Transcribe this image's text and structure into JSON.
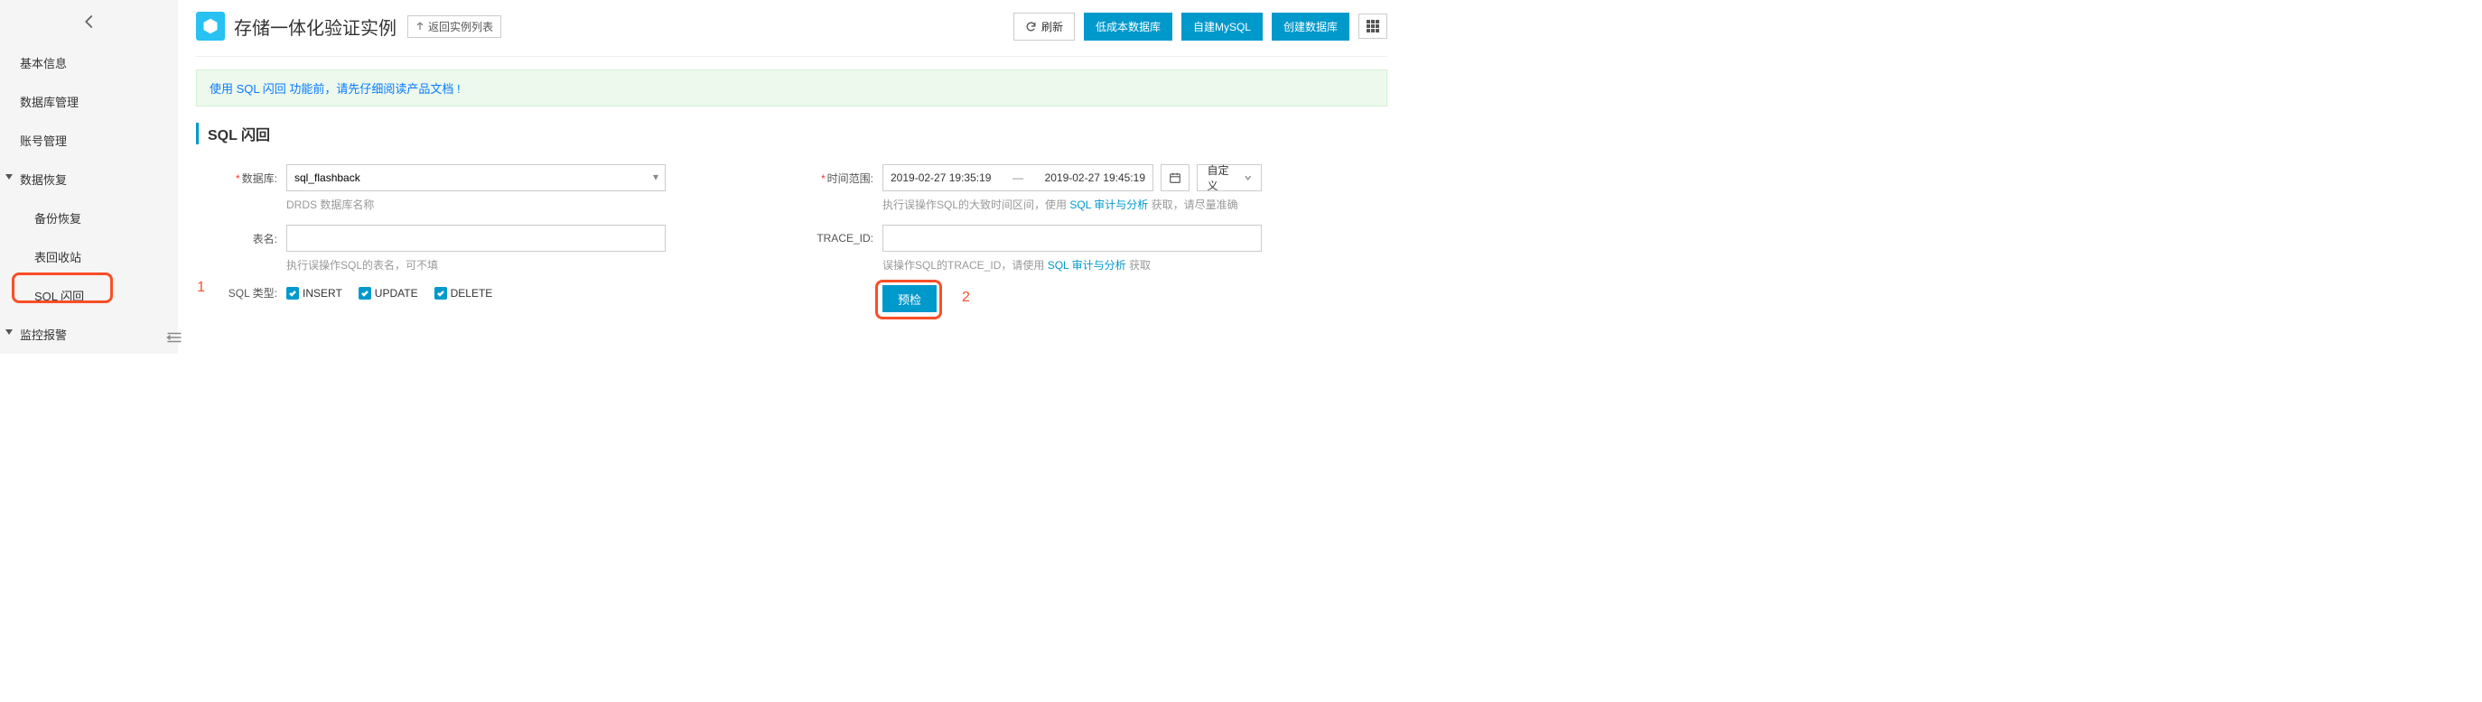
{
  "sidebar": {
    "items": [
      {
        "label": "基本信息"
      },
      {
        "label": "数据库管理"
      },
      {
        "label": "账号管理"
      }
    ],
    "group_recover": "数据恢复",
    "recover_children": [
      {
        "label": "备份恢复"
      },
      {
        "label": "表回收站"
      },
      {
        "label": "SQL 闪回"
      }
    ],
    "group_monitor": "监控报警",
    "annotation_1": "1"
  },
  "header": {
    "title": "存储一体化验证实例",
    "back_list": "返回实例列表",
    "refresh": "刷新",
    "btn_lowcost": "低成本数据库",
    "btn_selfmysql": "自建MySQL",
    "btn_createdb": "创建数据库"
  },
  "notice": {
    "text": "使用 SQL 闪回 功能前，请先仔细阅读产品文档 !"
  },
  "section_title": "SQL 闪回",
  "form": {
    "database_label": "数据库:",
    "database_value": "sql_flashback",
    "database_hint": "DRDS 数据库名称",
    "table_label": "表名:",
    "table_hint": "执行误操作SQL的表名，可不填",
    "sql_type_label": "SQL 类型:",
    "sql_types": [
      "INSERT",
      "UPDATE",
      "DELETE"
    ],
    "time_label": "时间范围:",
    "time_from": "2019-02-27 19:35:19",
    "time_to": "2019-02-27 19:45:19",
    "time_dash": "—",
    "time_preset": "自定义",
    "time_hint_prefix": "执行误操作SQL的大致时间区间，使用 ",
    "time_hint_link": "SQL 审计与分析",
    "time_hint_suffix": " 获取，请尽量准确",
    "trace_label": "TRACE_ID:",
    "trace_hint_prefix": "误操作SQL的TRACE_ID，请使用 ",
    "trace_hint_link": "SQL 审计与分析",
    "trace_hint_suffix": " 获取",
    "precheck": "预检",
    "annotation_2": "2"
  }
}
